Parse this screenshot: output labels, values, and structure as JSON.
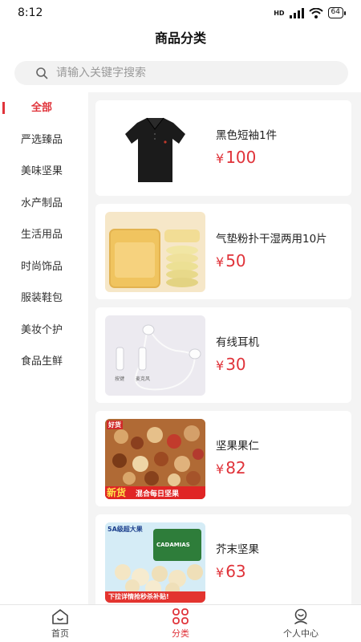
{
  "status_bar": {
    "time": "8:12",
    "network": "HD",
    "battery": "64"
  },
  "header": {
    "title": "商品分类"
  },
  "search": {
    "placeholder": "请输入关键字搜索"
  },
  "sidebar": {
    "items": [
      {
        "label": "全部",
        "active": true
      },
      {
        "label": "严选臻品"
      },
      {
        "label": "美味坚果"
      },
      {
        "label": "水产制品"
      },
      {
        "label": "生活用品"
      },
      {
        "label": "时尚饰品"
      },
      {
        "label": "服装鞋包"
      },
      {
        "label": "美妆个护"
      },
      {
        "label": "食品生鲜"
      }
    ]
  },
  "products": [
    {
      "name": "黑色短袖1件",
      "currency": "¥",
      "price": "100",
      "image": "black-polo-shirt"
    },
    {
      "name": "气垫粉扑干湿两用10片",
      "currency": "¥",
      "price": "50",
      "image": "cushion-puff-box"
    },
    {
      "name": "有线耳机",
      "currency": "¥",
      "price": "30",
      "image": "wired-earphones",
      "image_labels": [
        "按键",
        "麦克风"
      ]
    },
    {
      "name": "坚果果仁",
      "currency": "¥",
      "price": "82",
      "image": "mixed-nuts-bag",
      "image_labels": [
        "新货",
        "混合每日坚果",
        "好货"
      ]
    },
    {
      "name": "芥末坚果",
      "currency": "¥",
      "price": "63",
      "image": "macadamia-pack",
      "image_labels": [
        "5A级超大果",
        "下拉详情抢秒杀补贴!",
        "CADAMIAS"
      ]
    }
  ],
  "tabbar": {
    "items": [
      {
        "label": "首页",
        "icon": "home-icon"
      },
      {
        "label": "分类",
        "icon": "category-icon",
        "active": true
      },
      {
        "label": "个人中心",
        "icon": "user-icon"
      }
    ]
  },
  "colors": {
    "accent": "#e0333a",
    "content_bg": "#f4f4f4",
    "search_bg": "#f2f2f2"
  }
}
